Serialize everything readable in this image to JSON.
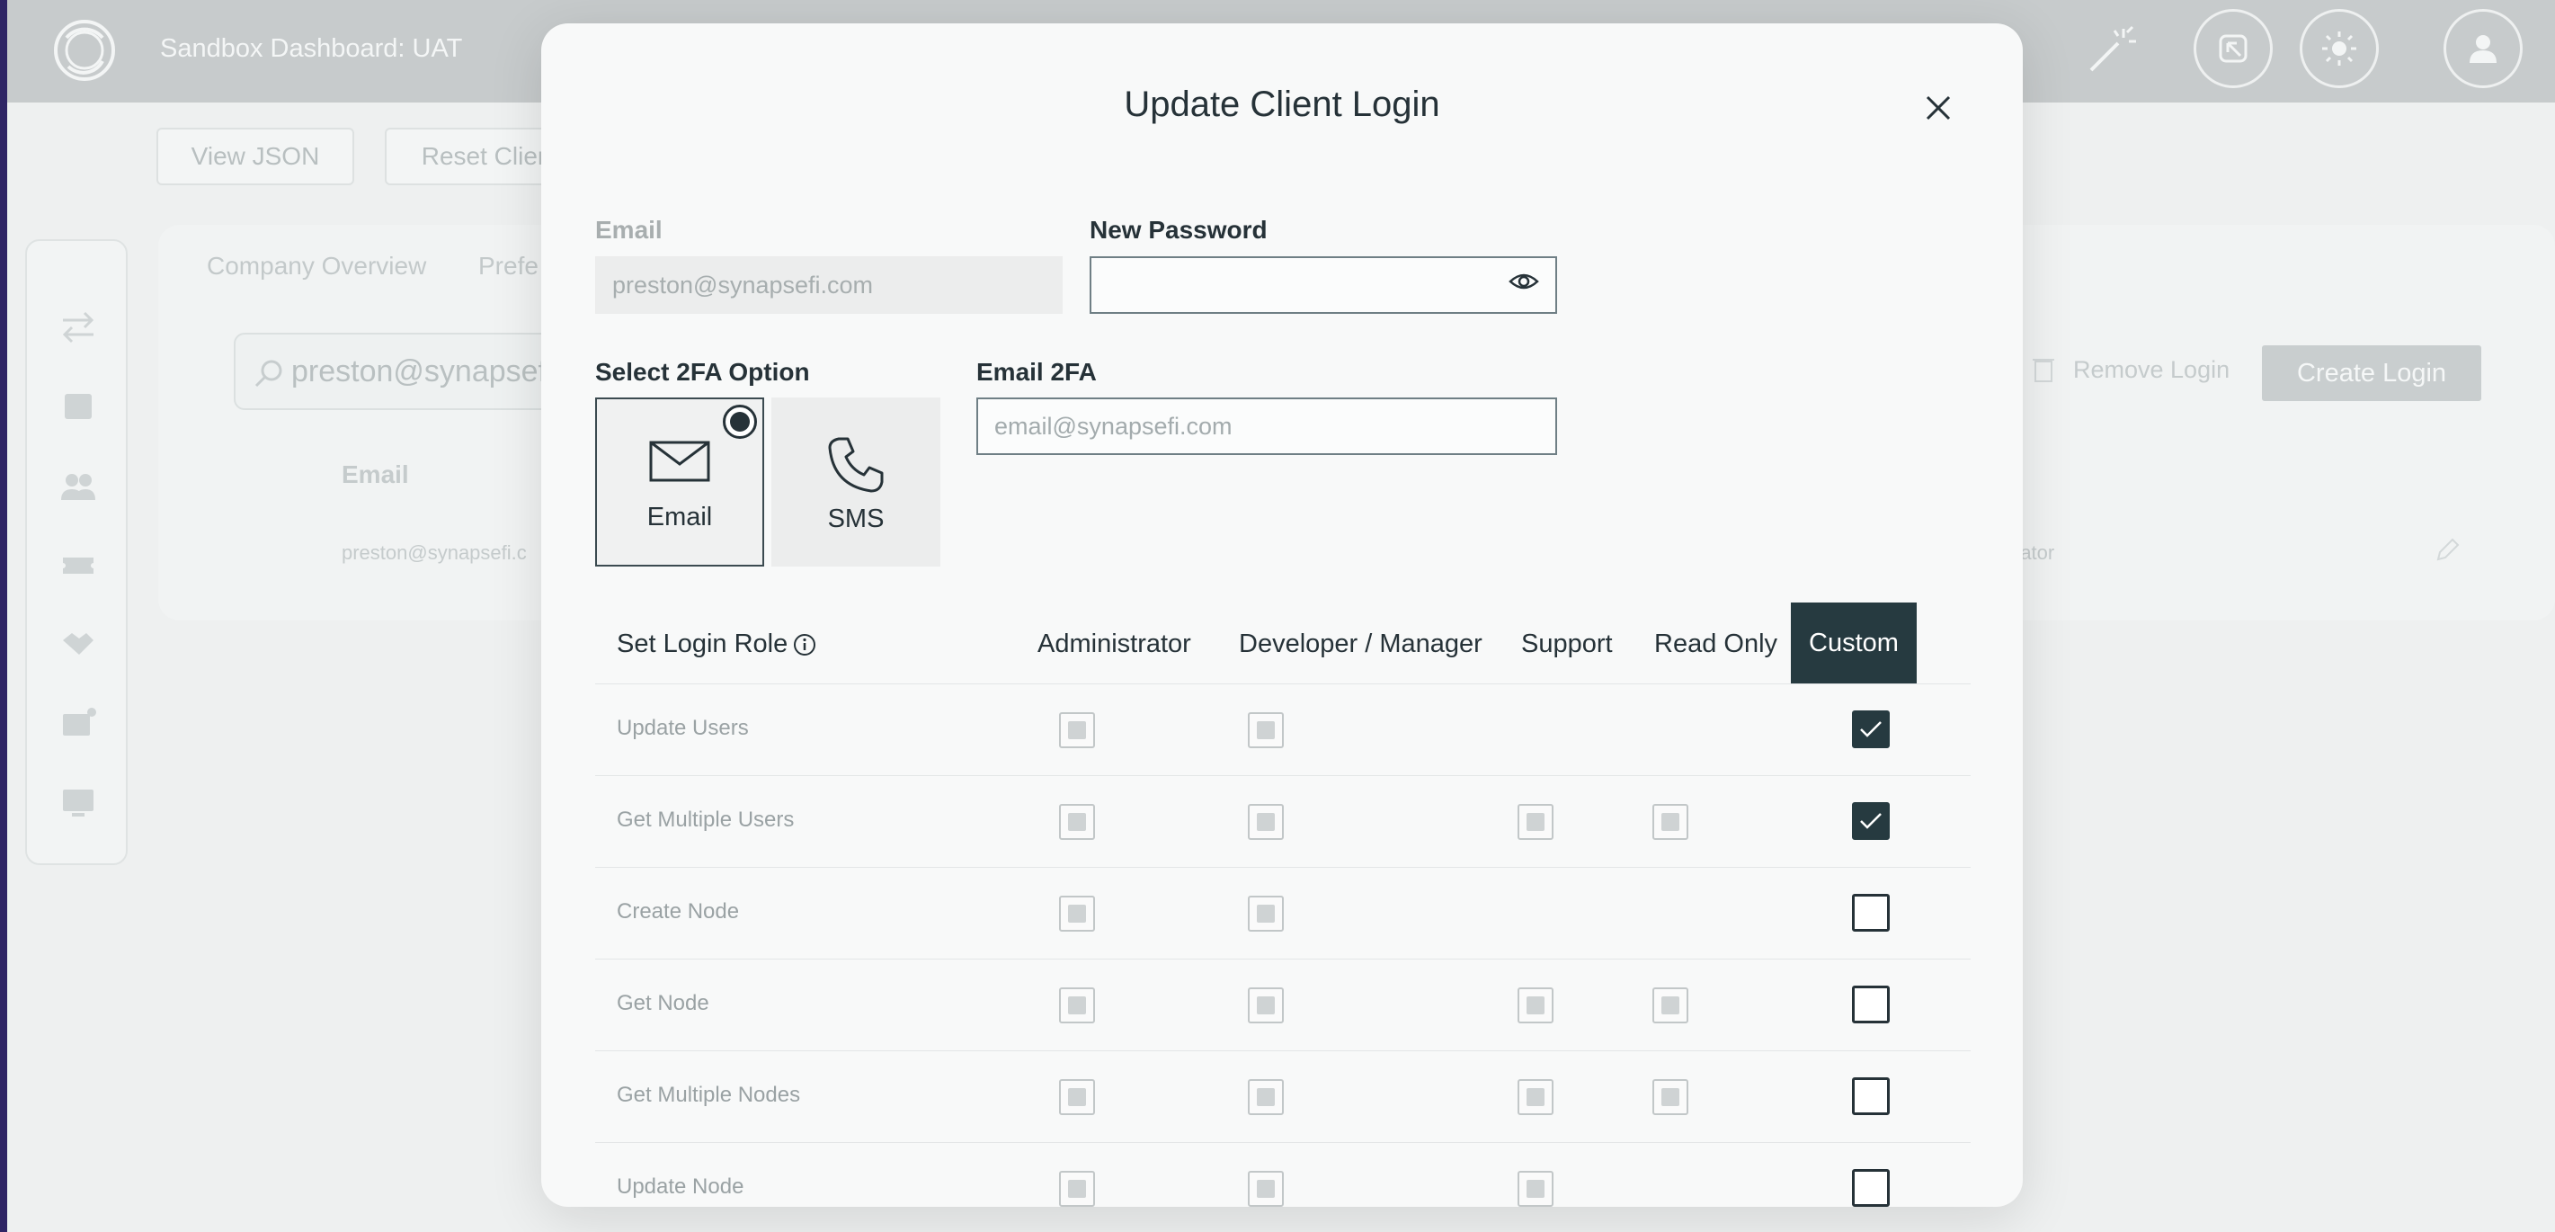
{
  "app": {
    "title": "Sandbox Dashboard: UAT",
    "toolbar": {
      "view_json_label": "View JSON",
      "reset_client_label": "Reset Clier"
    },
    "tabs": [
      "Company Overview",
      "Prefe"
    ],
    "search_value": "preston@synapsefi.c",
    "table_header_email": "Email",
    "table_row_email": "preston@synapsefi.c",
    "table_row_role": "rator",
    "remove_login_label": "Remove Login",
    "create_login_label": "Create Login"
  },
  "modal": {
    "title": "Update Client Login",
    "email_label": "Email",
    "email_value": "preston@synapsefi.com",
    "new_password_label": "New Password",
    "new_password_value": "",
    "twofa_label": "Select 2FA Option",
    "twofa_options": [
      {
        "label": "Email",
        "selected": true
      },
      {
        "label": "SMS",
        "selected": false
      }
    ],
    "email2fa_label": "Email 2FA",
    "email2fa_placeholder": "email@synapsefi.com",
    "role_label": "Set Login Role",
    "roles": [
      {
        "label": "Administrator",
        "active": false
      },
      {
        "label": "Developer / Manager",
        "active": false
      },
      {
        "label": "Support",
        "active": false
      },
      {
        "label": "Read Only",
        "active": false
      },
      {
        "label": "Custom",
        "active": true
      }
    ],
    "permissions": [
      {
        "name": "Update Users",
        "admin": true,
        "dev": true,
        "support": false,
        "read_only": false,
        "custom": true
      },
      {
        "name": "Get Multiple Users",
        "admin": true,
        "dev": true,
        "support": true,
        "read_only": true,
        "custom": true
      },
      {
        "name": "Create Node",
        "admin": true,
        "dev": true,
        "support": false,
        "read_only": false,
        "custom": false
      },
      {
        "name": "Get Node",
        "admin": true,
        "dev": true,
        "support": true,
        "read_only": true,
        "custom": false
      },
      {
        "name": "Get Multiple Nodes",
        "admin": true,
        "dev": true,
        "support": true,
        "read_only": true,
        "custom": false
      },
      {
        "name": "Update Node",
        "admin": true,
        "dev": true,
        "support": true,
        "read_only": false,
        "custom": false
      }
    ]
  }
}
